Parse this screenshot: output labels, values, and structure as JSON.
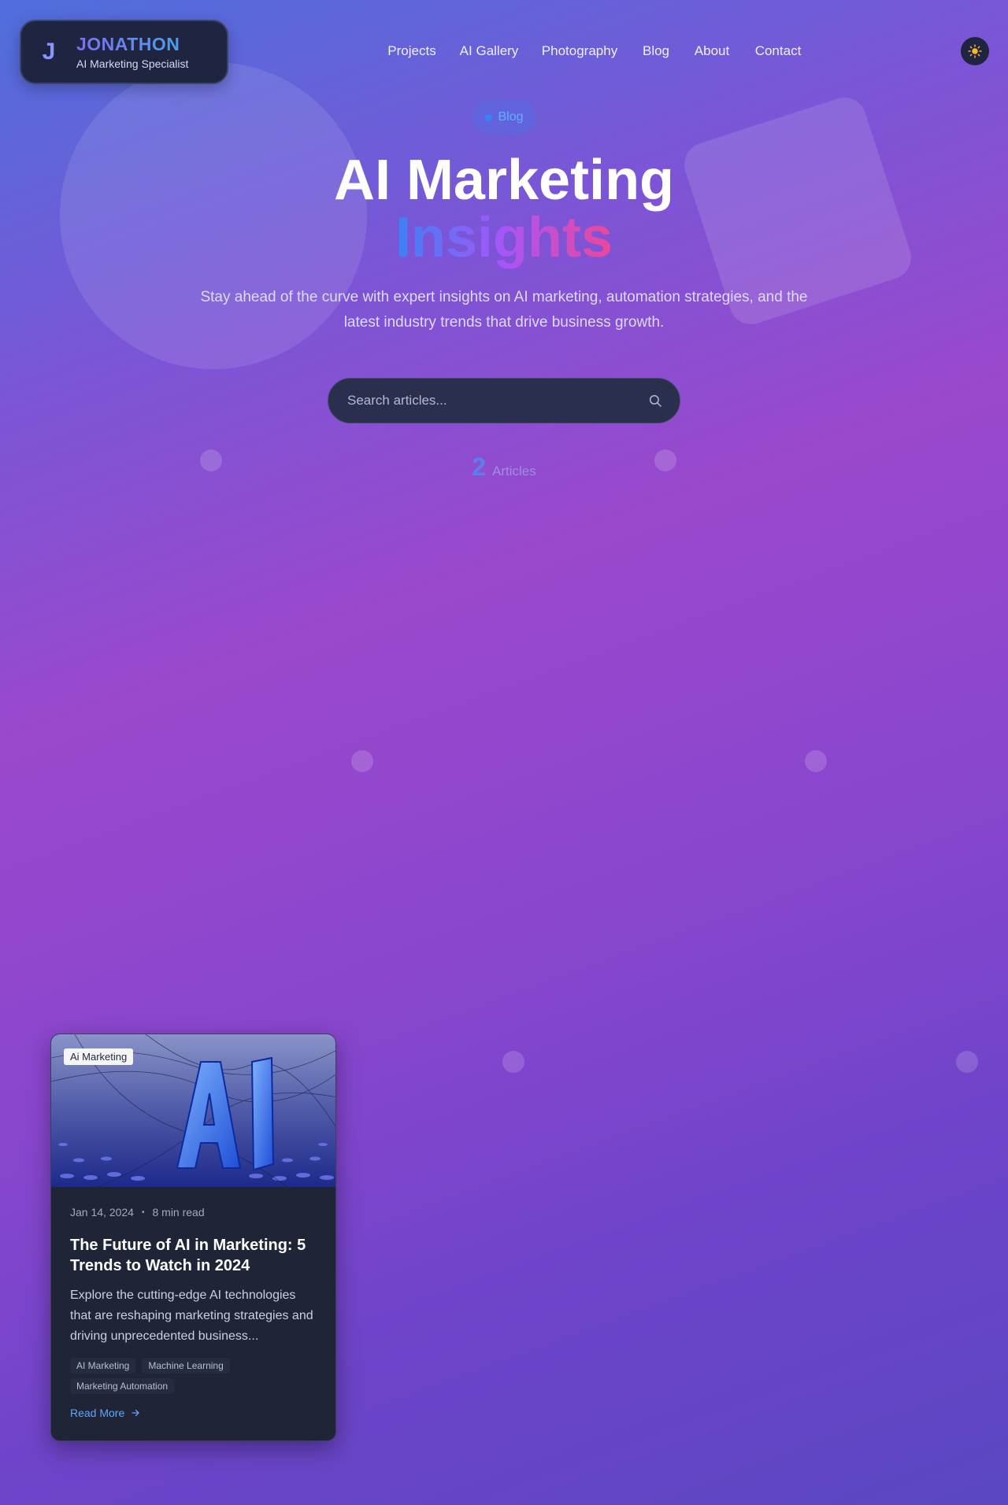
{
  "header": {
    "logo_letter": "J",
    "logo_name": "JONATHON",
    "logo_subtitle": "AI Marketing Specialist",
    "nav": [
      "Projects",
      "AI Gallery",
      "Photography",
      "Blog",
      "About",
      "Contact"
    ],
    "theme_icon": "sun-icon"
  },
  "hero": {
    "badge": "Blog",
    "title_line1": "AI Marketing",
    "title_line2": "Insights",
    "subtitle": "Stay ahead of the curve with expert insights on AI marketing, automation strategies, and the latest industry trends that drive business growth.",
    "search_placeholder": "Search articles...",
    "article_count": "2",
    "article_count_label": "Articles"
  },
  "articles": [
    {
      "category": "Ai Marketing",
      "date": "Jan 14, 2024",
      "read_time": "8 min read",
      "title": "The Future of AI in Marketing: 5 Trends to Watch in 2024",
      "excerpt": "Explore the cutting-edge AI technologies that are reshaping marketing strategies and driving unprecedented business...",
      "tags": [
        "AI Marketing",
        "Machine Learning",
        "Marketing Automation"
      ],
      "cta": "Read More"
    }
  ],
  "colors": {
    "accent_blue": "#3b82f6",
    "accent_purple": "#a855f7",
    "accent_pink": "#ec4899",
    "card_bg": "#1f2536",
    "header_bg": "#1f2440"
  }
}
